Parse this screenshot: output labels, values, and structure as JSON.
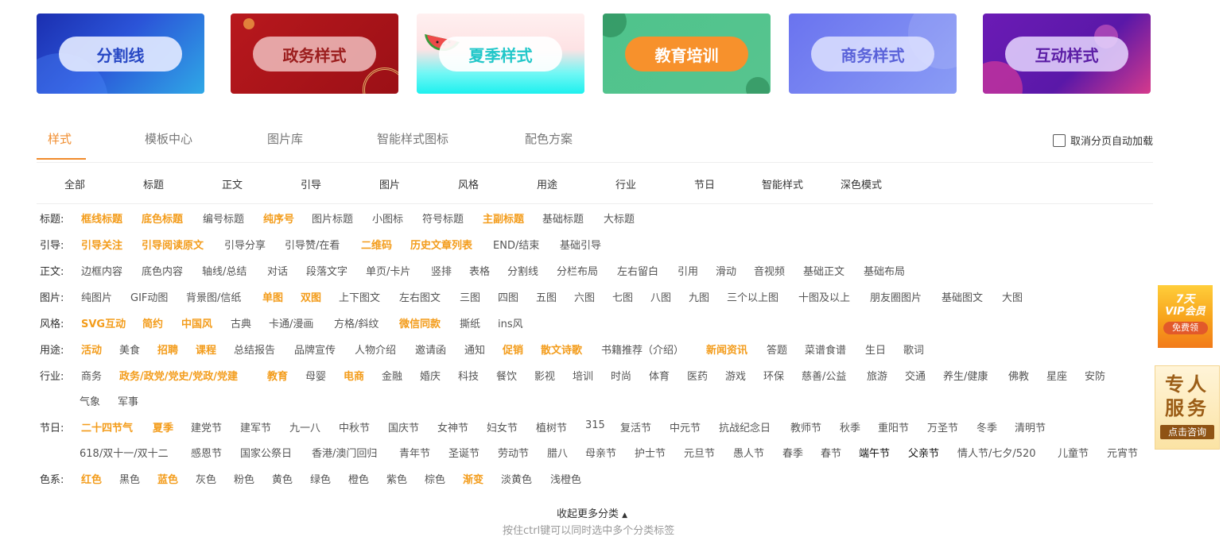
{
  "banners": [
    {
      "label": "分割线"
    },
    {
      "label": "政务样式"
    },
    {
      "label": "夏季样式"
    },
    {
      "label": "教育培训"
    },
    {
      "label": "商务样式"
    },
    {
      "label": "互动样式"
    }
  ],
  "tabs": [
    {
      "label": "样式",
      "active": true
    },
    {
      "label": "模板中心"
    },
    {
      "label": "图片库"
    },
    {
      "label": "智能样式图标"
    },
    {
      "label": "配色方案"
    }
  ],
  "auto_load_checkbox": {
    "label": "取消分页自动加载",
    "checked": false
  },
  "categories": [
    "全部",
    "标题",
    "正文",
    "引导",
    "图片",
    "风格",
    "用途",
    "行业",
    "节日",
    "智能样式",
    "深色模式"
  ],
  "rows": {
    "title": {
      "label": "标题:",
      "tags": [
        "框线标题",
        "底色标题",
        "编号标题",
        "纯序号",
        "图片标题",
        "小图标",
        "符号标题",
        "主副标题",
        "基础标题",
        "大标题"
      ]
    },
    "guide": {
      "label": "引导:",
      "tags": [
        "引导关注",
        "引导阅读原文",
        "引导分享",
        "引导赞/在看",
        "二维码",
        "历史文章列表",
        "END/结束",
        "基础引导"
      ]
    },
    "body": {
      "label": "正文:",
      "tags": [
        "边框内容",
        "底色内容",
        "轴线/总结",
        "对话",
        "段落文字",
        "单页/卡片",
        "竖排",
        "表格",
        "分割线",
        "分栏布局",
        "左右留白",
        "引用",
        "滑动",
        "音视频",
        "基础正文",
        "基础布局"
      ]
    },
    "image": {
      "label": "图片:",
      "tags": [
        "纯图片",
        "GIF动图",
        "背景图/信纸",
        "单图",
        "双图",
        "上下图文",
        "左右图文",
        "三图",
        "四图",
        "五图",
        "六图",
        "七图",
        "八图",
        "九图",
        "三个以上图",
        "十图及以上",
        "朋友圈图片",
        "基础图文",
        "大图"
      ]
    },
    "style": {
      "label": "风格:",
      "tags": [
        "SVG互动",
        "简约",
        "中国风",
        "古典",
        "卡通/漫画",
        "方格/斜纹",
        "微信同款",
        "撕纸",
        "ins风"
      ]
    },
    "usage": {
      "label": "用途:",
      "tags": [
        "活动",
        "美食",
        "招聘",
        "课程",
        "总结报告",
        "品牌宣传",
        "人物介绍",
        "邀请函",
        "通知",
        "促销",
        "散文诗歌",
        "书籍推荐（介绍）",
        "新闻资讯",
        "答题",
        "菜谱食谱",
        "生日",
        "歌词"
      ]
    },
    "industry": {
      "label": "行业:",
      "tags": [
        "商务",
        "政务/政党/党史/党政/党建",
        "教育",
        "母婴",
        "电商",
        "金融",
        "婚庆",
        "科技",
        "餐饮",
        "影视",
        "培训",
        "时尚",
        "体育",
        "医药",
        "游戏",
        "环保",
        "慈善/公益",
        "旅游",
        "交通",
        "养生/健康",
        "佛教",
        "星座",
        "安防",
        "气象",
        "军事"
      ]
    },
    "holiday": {
      "label": "节日:",
      "tags": [
        "二十四节气",
        "夏季",
        "建党节",
        "建军节",
        "九一八",
        "中秋节",
        "国庆节",
        "女神节",
        "妇女节",
        "植树节",
        "315",
        "复活节",
        "中元节",
        "抗战纪念日",
        "教师节",
        "秋季",
        "重阳节",
        "万圣节",
        "冬季",
        "清明节",
        "618/双十一/双十二",
        "感恩节",
        "国家公祭日",
        "香港/澳门回归",
        "青年节",
        "圣诞节",
        "劳动节",
        "腊八",
        "母亲节",
        "护士节",
        "元旦节",
        "愚人节",
        "春季",
        "春节",
        "端午节",
        "父亲节",
        "情人节/七夕/520",
        "儿童节",
        "元宵节"
      ]
    },
    "color": {
      "label": "色系:",
      "tags": [
        "红色",
        "黑色",
        "蓝色",
        "灰色",
        "粉色",
        "黄色",
        "绿色",
        "橙色",
        "紫色",
        "棕色",
        "渐变",
        "淡黄色",
        "浅橙色"
      ]
    }
  },
  "collapse_label": "收起更多分类",
  "hint": "按住ctrl键可以同时选中多个分类标签",
  "side_vip": {
    "line1": "7天",
    "line2": "VIP会员",
    "button": "免费领"
  },
  "side_consult": {
    "line1": "专人",
    "line2": "服务",
    "button": "点击咨询"
  },
  "colors": {
    "accent": "#f08b2b",
    "highlight_tag": "#f39c1b"
  }
}
